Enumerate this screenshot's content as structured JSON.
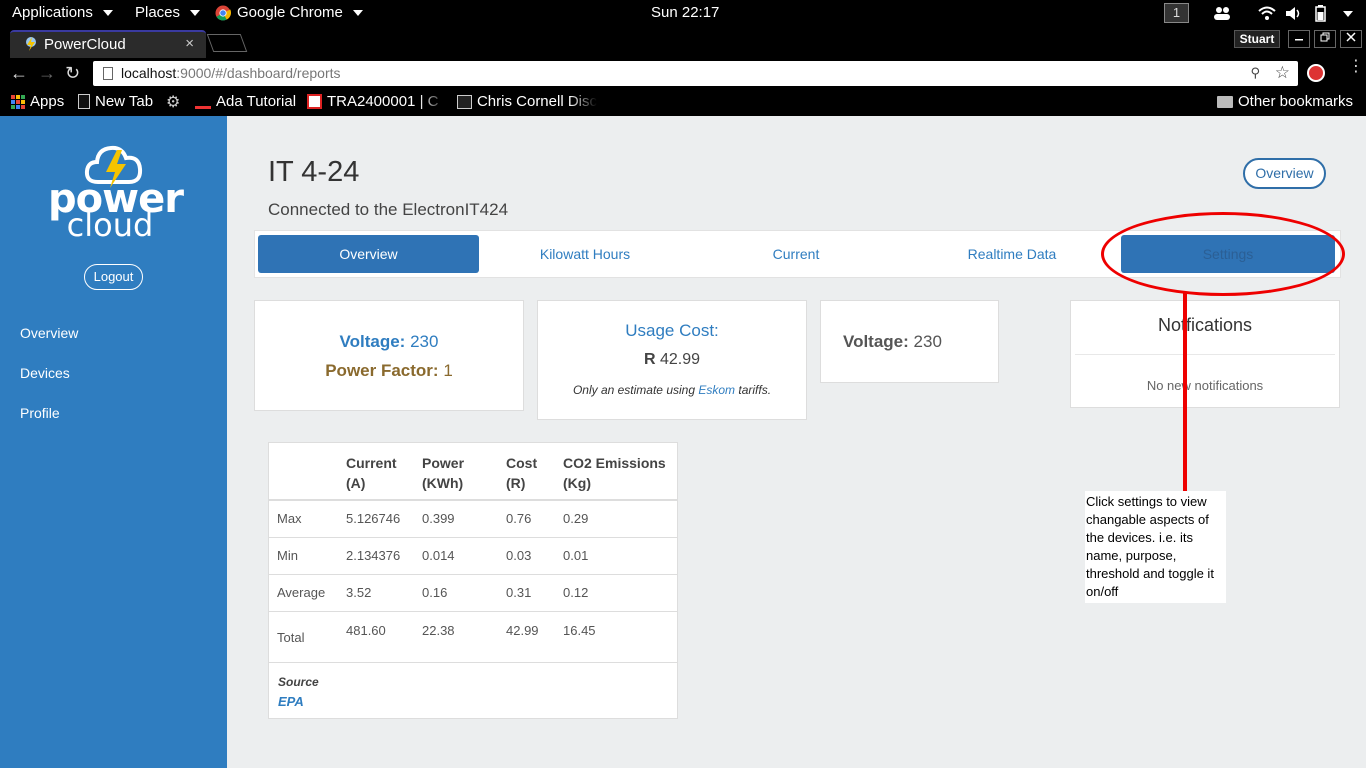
{
  "os": {
    "applications": "Applications",
    "places": "Places",
    "active_app": "Google Chrome",
    "clock": "Sun 22:17",
    "workspace": "1"
  },
  "browser": {
    "tab_title": "PowerCloud",
    "tab_close": "×",
    "profile": "Stuart",
    "url_host": "localhost",
    "url_rest": ":9000/#/dashboard/reports",
    "bookmarks": {
      "apps": "Apps",
      "new_tab": "New Tab",
      "ada": "Ada Tutorial",
      "tra": "TRA2400001 | C",
      "chris": "Chris Cornell Disc",
      "other": "Other bookmarks"
    }
  },
  "sidebar": {
    "logo_word1": "power",
    "logo_word2": "cloud",
    "logout": "Logout",
    "items": [
      "Overview",
      "Devices",
      "Profile"
    ]
  },
  "header": {
    "title": "IT 4-24",
    "subtitle": "Connected to the ElectronIT424",
    "overview_button": "Overview"
  },
  "tabs": [
    "Overview",
    "Kilowatt Hours",
    "Current",
    "Realtime Data",
    "Settings"
  ],
  "cards": {
    "voltage_label": "Voltage:",
    "voltage_value": "230",
    "power_factor_label": "Power Factor:",
    "power_factor_value": "1",
    "usage_cost_title": "Usage Cost:",
    "currency": "R",
    "usage_cost_value": "42.99",
    "estimate_pre": "Only an estimate using ",
    "estimate_link": "Eskom",
    "estimate_post": " tariffs.",
    "voltage2_label": "Voltage:",
    "voltage2_value": "230"
  },
  "notifications": {
    "title": "Notfications",
    "empty": "No new notifications"
  },
  "stats": {
    "headers": [
      [
        "",
        ""
      ],
      [
        "Current",
        "(A)"
      ],
      [
        "Power",
        "(KWh)"
      ],
      [
        "Cost",
        "(R)"
      ],
      [
        "CO2 Emissions",
        "(Kg)"
      ]
    ],
    "rows": [
      [
        "Max",
        "5.126746",
        "0.399",
        "0.76",
        "0.29"
      ],
      [
        "Min",
        "2.134376",
        "0.014",
        "0.03",
        "0.01"
      ],
      [
        "Average",
        "3.52",
        "0.16",
        "0.31",
        "0.12"
      ],
      [
        "Total",
        "481.60",
        "22.38",
        "42.99",
        "16.45"
      ]
    ],
    "source_label": "Source",
    "source_link": "EPA"
  },
  "annotation": "Click settings to view changable aspects of the devices. i.e. its name, purpose, threshold and toggle it on/off",
  "colors": {
    "sidebar": "#2f7dc0",
    "primary": "#2f73b5",
    "annotation": "#e00000"
  }
}
